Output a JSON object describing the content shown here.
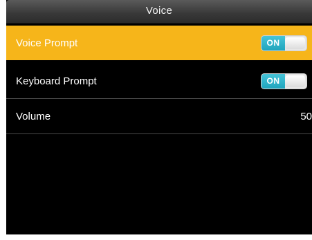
{
  "header": {
    "title": "Voice"
  },
  "settings": [
    {
      "label": "Voice Prompt",
      "state": "ON",
      "selected": true
    },
    {
      "label": "Keyboard Prompt",
      "state": "ON",
      "selected": false
    },
    {
      "label": "Volume",
      "value": "50",
      "selected": false
    }
  ],
  "colors": {
    "selected_row": "#f6b51a",
    "toggle_on": "#1fa5bd",
    "background": "#000000",
    "title_bar": "#383838"
  }
}
